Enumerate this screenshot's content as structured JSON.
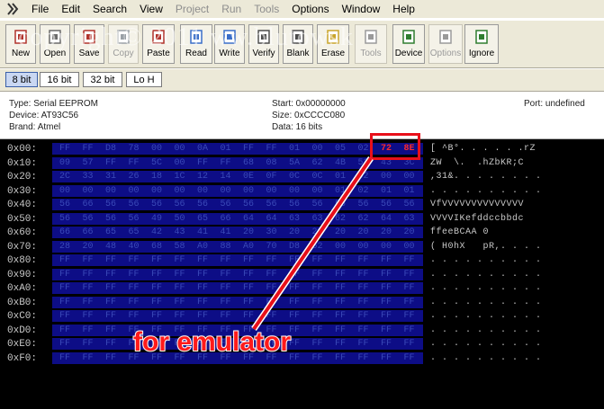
{
  "menu": [
    "File",
    "Edit",
    "Search",
    "View",
    "Project",
    "Run",
    "Tools",
    "Options",
    "Window",
    "Help"
  ],
  "menu_disabled": [
    "Project",
    "Run",
    "Tools"
  ],
  "toolbar": [
    {
      "label": "New",
      "icon": "new-icon",
      "disabled": false
    },
    {
      "label": "Open",
      "icon": "open-icon",
      "disabled": false
    },
    {
      "label": "Save",
      "icon": "save-icon",
      "disabled": false
    },
    {
      "label": "Copy",
      "icon": "copy-icon",
      "disabled": true
    },
    {
      "label": "Paste",
      "icon": "paste-icon",
      "disabled": false
    },
    {
      "label": "Read",
      "icon": "read-icon",
      "disabled": false
    },
    {
      "label": "Write",
      "icon": "write-icon",
      "disabled": false
    },
    {
      "label": "Verify",
      "icon": "verify-icon",
      "disabled": false
    },
    {
      "label": "Blank",
      "icon": "blank-icon",
      "disabled": false
    },
    {
      "label": "Erase",
      "icon": "erase-icon",
      "disabled": false
    },
    {
      "label": "Tools",
      "icon": "tools-icon",
      "disabled": true
    },
    {
      "label": "Device",
      "icon": "device-icon",
      "disabled": false
    },
    {
      "label": "Options",
      "icon": "options-icon",
      "disabled": true
    },
    {
      "label": "Ignore",
      "icon": "ignore-icon",
      "disabled": false
    }
  ],
  "modes": {
    "m8": "8 bit",
    "m16": "16 bit",
    "m32": "32 bit",
    "lohi": "Lo H"
  },
  "info": {
    "type": "Type: Serial EEPROM",
    "device": "Device: AT93C56",
    "brand": "Brand: Atmel",
    "start": "Start: 0x00000000",
    "size": "Size: 0xCCCC080",
    "data": "Data: 16 bits",
    "port": "Port: undefined"
  },
  "watermark": "copyright© 2011 ww.blutowsk",
  "hex_rows": [
    {
      "addr": "0x00:",
      "bytes": [
        "FF",
        "FF",
        "D8",
        "78",
        "00",
        "00",
        "0A",
        "01",
        "FF",
        "FF",
        "01",
        "00",
        "05",
        "02",
        "72",
        "8E"
      ],
      "ascii": "[ ^B°. . . . . .rZ"
    },
    {
      "addr": "0x10:",
      "bytes": [
        "09",
        "57",
        "FF",
        "FF",
        "5C",
        "00",
        "FF",
        "FF",
        "68",
        "08",
        "5A",
        "62",
        "4B",
        "52",
        "43",
        "3C"
      ],
      "ascii": "ZW  \\.  .hZbKR;C"
    },
    {
      "addr": "0x20:",
      "bytes": [
        "2C",
        "33",
        "31",
        "26",
        "18",
        "1C",
        "12",
        "14",
        "0E",
        "0F",
        "0C",
        "0C",
        "01",
        "02",
        "00",
        "00"
      ],
      "ascii": ",31&. . . . . . . ."
    },
    {
      "addr": "0x30:",
      "bytes": [
        "00",
        "00",
        "00",
        "00",
        "00",
        "00",
        "00",
        "00",
        "00",
        "00",
        "00",
        "00",
        "01",
        "02",
        "01",
        "01"
      ],
      "ascii": ". . . . . . . . . ."
    },
    {
      "addr": "0x40:",
      "bytes": [
        "56",
        "66",
        "56",
        "56",
        "56",
        "56",
        "56",
        "56",
        "56",
        "56",
        "56",
        "56",
        "56",
        "56",
        "56",
        "56"
      ],
      "ascii": "VfVVVVVVVVVVVVVV"
    },
    {
      "addr": "0x50:",
      "bytes": [
        "56",
        "56",
        "56",
        "56",
        "49",
        "50",
        "65",
        "66",
        "64",
        "64",
        "63",
        "63",
        "62",
        "62",
        "64",
        "63"
      ],
      "ascii": "VVVVIKefddccbbdc"
    },
    {
      "addr": "0x60:",
      "bytes": [
        "66",
        "66",
        "65",
        "65",
        "42",
        "43",
        "41",
        "41",
        "20",
        "30",
        "20",
        "20",
        "20",
        "20",
        "20",
        "20"
      ],
      "ascii": "ffeeBCAA 0      "
    },
    {
      "addr": "0x70:",
      "bytes": [
        "28",
        "20",
        "48",
        "40",
        "68",
        "58",
        "A0",
        "88",
        "A0",
        "70",
        "D8",
        "52",
        "00",
        "00",
        "00",
        "00"
      ],
      "ascii": "( H0hX   pR,. . . ."
    },
    {
      "addr": "0x80:",
      "bytes": [
        "FF",
        "FF",
        "FF",
        "FF",
        "FF",
        "FF",
        "FF",
        "FF",
        "FF",
        "FF",
        "FF",
        "FF",
        "FF",
        "FF",
        "FF",
        "FF"
      ],
      "ascii": ". . . . . . . . . ."
    },
    {
      "addr": "0x90:",
      "bytes": [
        "FF",
        "FF",
        "FF",
        "FF",
        "FF",
        "FF",
        "FF",
        "FF",
        "FF",
        "FF",
        "FF",
        "FF",
        "FF",
        "FF",
        "FF",
        "FF"
      ],
      "ascii": ". . . . . . . . . ."
    },
    {
      "addr": "0xA0:",
      "bytes": [
        "FF",
        "FF",
        "FF",
        "FF",
        "FF",
        "FF",
        "FF",
        "FF",
        "FF",
        "FF",
        "FF",
        "FF",
        "FF",
        "FF",
        "FF",
        "FF"
      ],
      "ascii": ". . . . . . . . . ."
    },
    {
      "addr": "0xB0:",
      "bytes": [
        "FF",
        "FF",
        "FF",
        "FF",
        "FF",
        "FF",
        "FF",
        "FF",
        "FF",
        "FF",
        "FF",
        "FF",
        "FF",
        "FF",
        "FF",
        "FF"
      ],
      "ascii": ". . . . . . . . . ."
    },
    {
      "addr": "0xC0:",
      "bytes": [
        "FF",
        "FF",
        "FF",
        "FF",
        "FF",
        "FF",
        "FF",
        "FF",
        "FF",
        "FF",
        "FF",
        "FF",
        "FF",
        "FF",
        "FF",
        "FF"
      ],
      "ascii": ". . . . . . . . . ."
    },
    {
      "addr": "0xD0:",
      "bytes": [
        "FF",
        "FF",
        "FF",
        "FF",
        "FF",
        "FF",
        "FF",
        "FF",
        "FF",
        "FF",
        "FF",
        "FF",
        "FF",
        "FF",
        "FF",
        "FF"
      ],
      "ascii": ". . . . . . . . . ."
    },
    {
      "addr": "0xE0:",
      "bytes": [
        "FF",
        "FF",
        "FF",
        "FF",
        "FF",
        "FF",
        "FF",
        "FF",
        "FF",
        "FF",
        "FF",
        "FF",
        "FF",
        "FF",
        "FF",
        "FF"
      ],
      "ascii": ". . . . . . . . . ."
    },
    {
      "addr": "0xF0:",
      "bytes": [
        "FF",
        "FF",
        "FF",
        "FF",
        "FF",
        "FF",
        "FF",
        "FF",
        "FF",
        "FF",
        "FF",
        "FF",
        "FF",
        "FF",
        "FF",
        "FF"
      ],
      "ascii": ". . . . . . . . . ."
    }
  ],
  "highlight_text": "72 8E",
  "annotation": "for emulator",
  "colors": {
    "annotation": "#ff1a1a",
    "hexbg": "#0d0d86",
    "panel": "#000000"
  }
}
